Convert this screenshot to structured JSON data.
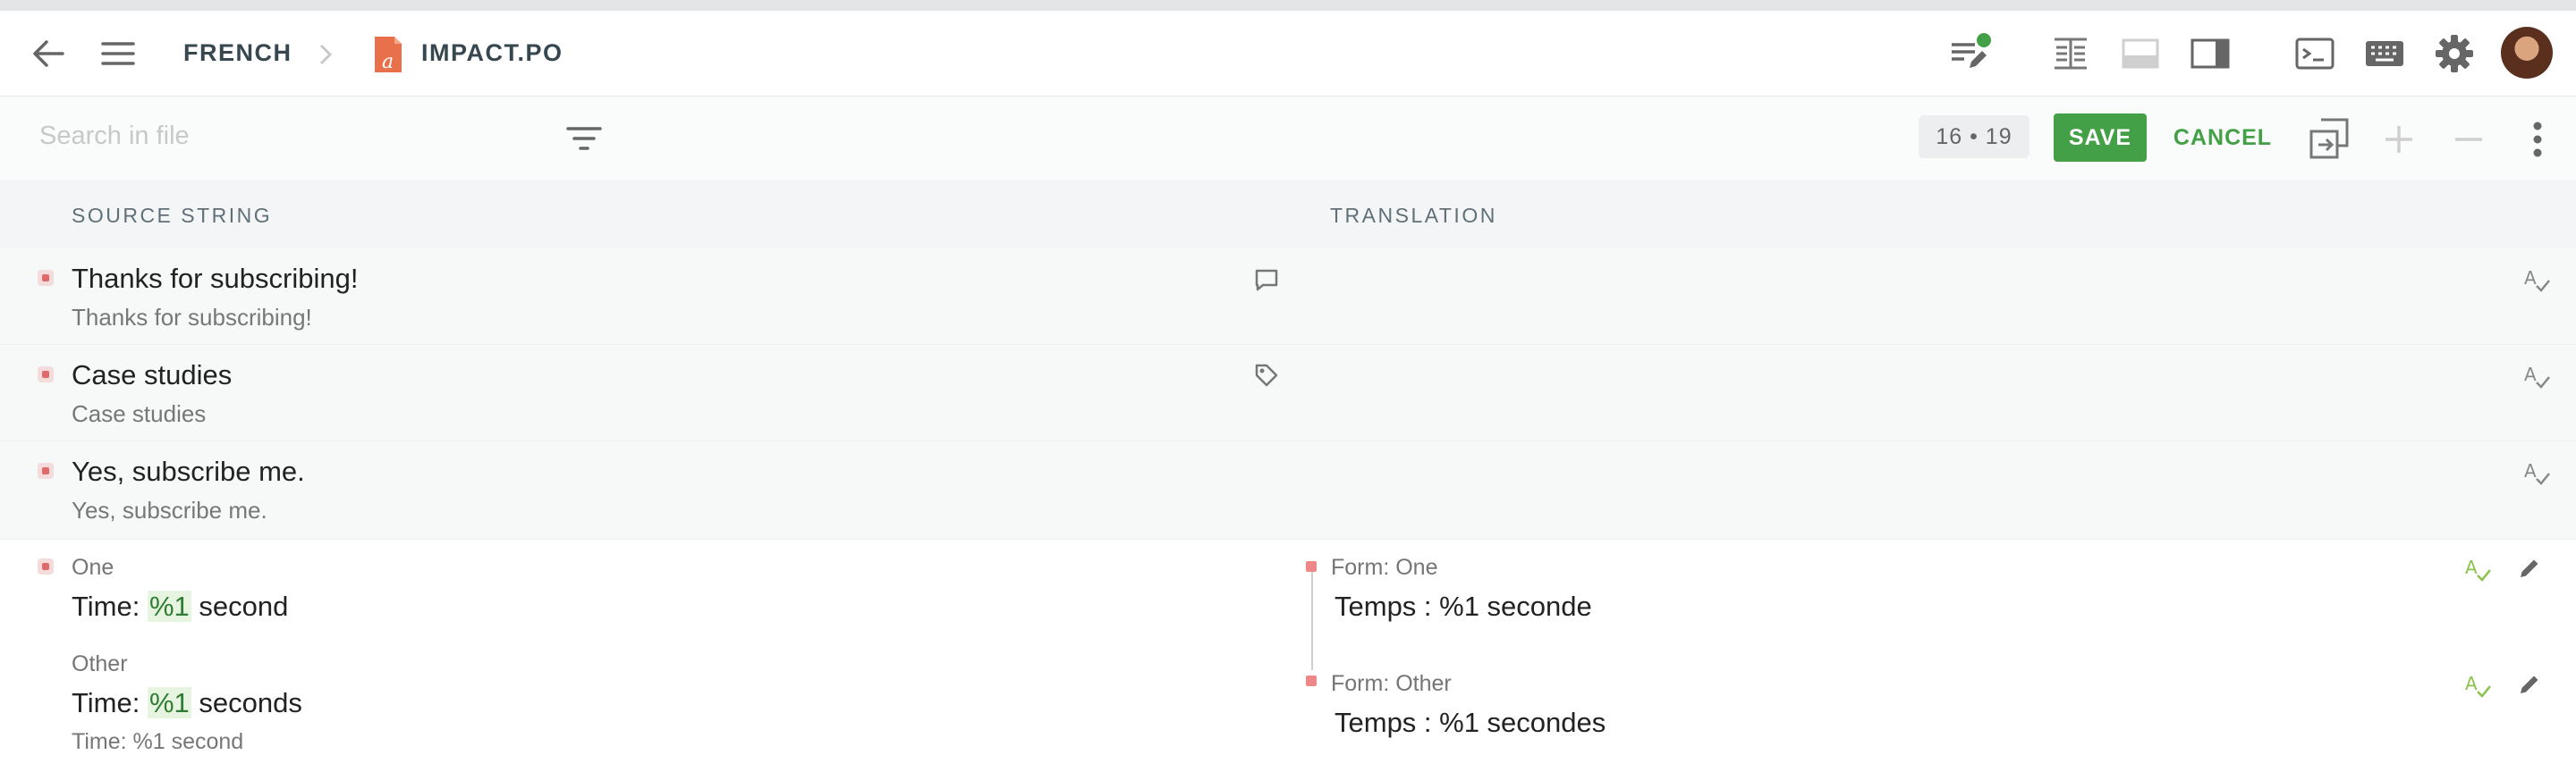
{
  "header": {
    "language": "FRENCH",
    "file_name": "IMPACT.PO"
  },
  "search": {
    "placeholder": "Search in file"
  },
  "toolbar": {
    "counter": "16 • 19",
    "save_label": "SAVE",
    "cancel_label": "CANCEL"
  },
  "columns": {
    "source": "SOURCE STRING",
    "translation": "TRANSLATION"
  },
  "rows": [
    {
      "main": "Thanks for subscribing!",
      "sub": "Thanks for subscribing!"
    },
    {
      "main": "Case studies",
      "sub": "Case studies"
    },
    {
      "main": "Yes, subscribe me.",
      "sub": "Yes, subscribe me."
    }
  ],
  "plural": {
    "source_one_label": "One",
    "source_one_prefix": "Time: ",
    "source_one_placeholder": "%1",
    "source_one_suffix": " second",
    "source_other_label": "Other",
    "source_other_prefix": "Time: ",
    "source_other_placeholder": "%1",
    "source_other_suffix": " seconds",
    "source_context": "Time: %1 second",
    "trans_one_label": "Form: One",
    "trans_one_text": "Temps : %1 seconde",
    "trans_other_label": "Form: Other",
    "trans_other_text": "Temps : %1 secondes"
  },
  "colors": {
    "accent_green": "#43a047",
    "untranslated_red": "#e06a6a",
    "file_icon_orange": "#e8704a",
    "status_green_dot": "#43a047"
  }
}
